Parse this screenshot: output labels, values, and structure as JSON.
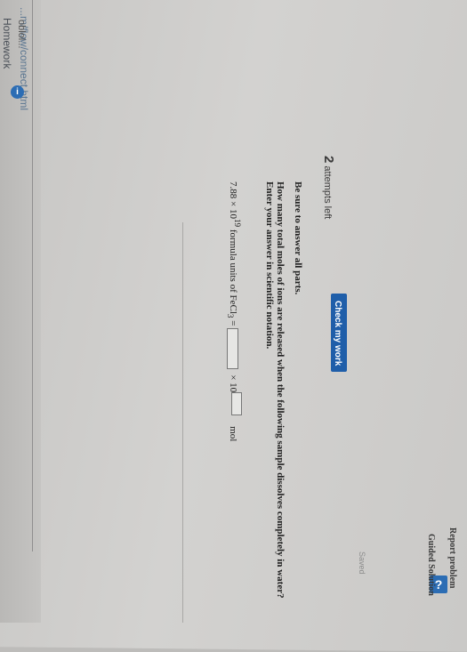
{
  "browser": {
    "url_fragment": "...m/flow/connect.html",
    "tab_title": "oblol...",
    "section_title": "Homework",
    "info_icon": "i"
  },
  "status": {
    "attempts_count": "2",
    "attempts_label": "attempts left",
    "saved": "Saved"
  },
  "buttons": {
    "check_my_work": "Check my work",
    "help": "?",
    "report_problem": "Report problem",
    "guided_solution": "Guided Solution"
  },
  "question": {
    "instruction": "Be sure to answer all parts.",
    "line1": "How many total moles of ions are released when the following sample dissolves completely in water?",
    "line2": "Enter your answer in scientific notation.",
    "prefix_mantissa": "7.88 × 10",
    "prefix_exponent": "19",
    "prefix_tail": " formula units of FeCl",
    "prefix_sub": "3",
    "equals": " = ",
    "times_ten": "× 10",
    "unit": "mol"
  },
  "colors": {
    "accent_blue": "#1f5ea9",
    "icon_blue": "#2c6db4"
  }
}
